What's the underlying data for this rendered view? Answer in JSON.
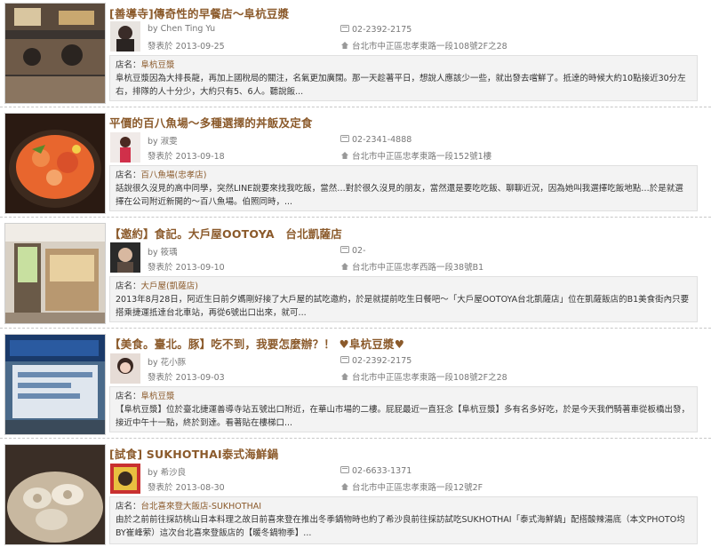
{
  "entries": [
    {
      "title": "[善導寺]傳奇性的早餐店～阜杭豆漿",
      "author": "by Chen Ting Yu",
      "date": "發表於 2013-09-25",
      "phone": "02-2392-2175",
      "address": "台北市中正區忠孝東路一段108號2F之28",
      "shop_label": "店名：",
      "shop_name": "阜杭豆漿",
      "excerpt": "阜杭豆漿因為大排長龍，再加上國稅局的關注，名氣更加廣闊。那一天趁著平日，想說人應該少一些，就出發去嚐鮮了。抵達的時候大約10點接近30分左右，排隊的人十分少，大約只有5、6人。聽說飯..."
    },
    {
      "title": "平價的百八魚場～多種選擇的丼飯及定食",
      "author": "by 淑雯",
      "date": "發表於 2013-09-18",
      "phone": "02-2341-4888",
      "address": "台北市中正區忠孝東路一段152號1樓",
      "shop_label": "店名：",
      "shop_name": "百八魚場(忠孝店)",
      "excerpt": "話說很久沒見的高中同學，突然LINE說要來找我吃飯，當然…對於很久沒見的朋友，當然還是要吃吃飯、聊聊近況，因為她叫我選擇吃飯地點…於是就選擇在公司附近新開的～百八魚場。伯照同時，..."
    },
    {
      "title": "【邀約】食記。大戶屋OOTOYA　台北凱薩店",
      "author": "by 筱瑀",
      "date": "發表於 2013-09-10",
      "phone": "02-",
      "address": "台北市中正區忠孝西路一段38號B1",
      "shop_label": "店名：",
      "shop_name": "大戶屋(凱薩店)",
      "excerpt": "2013年8月28日，阿近生日前夕媽剛好接了大戶屋的試吃邀約，於是就提前吃生日餐吧～「大戶屋OOTOYA台北凱薩店」位在凱薩飯店的B1美食街內只要搭乘捷運抵達台北車站，再從6號出口出來，就可..."
    },
    {
      "title": "【美食。臺北。豚】吃不到，我要怎麼辦？！ ♥阜杭豆漿♥",
      "author": "by 花小豚",
      "date": "發表於 2013-09-03",
      "phone": "02-2392-2175",
      "address": "台北市中正區忠孝東路一段108號2F之28",
      "shop_label": "店名：",
      "shop_name": "阜杭豆漿",
      "excerpt": "【阜杭豆漿】位於臺北捷運善導寺站五號出口附近，在華山市場的二樓。屁屁最近一直狂念【阜杭豆漿】多有名多好吃，於是今天我們騎著車從板橋出發，接近中午十一點，終於到達。看著貼在樓梯口..."
    },
    {
      "title": "[試食] SUKHOTHAI泰式海鮮鍋",
      "author": "by 希沙良",
      "date": "發表於 2013-08-30",
      "phone": "02-6633-1371",
      "address": "台北市中正區忠孝東路一段12號2F",
      "shop_label": "店名：",
      "shop_name": "台北喜來登大飯店-SUKHOTHAI",
      "excerpt": "由於之前前往採訪桃山日本料理之故日前喜來登在推出冬季鍋物時也約了希沙良前往採訪試吃SUKHOTHAI「泰式海鮮鍋」配搭酸辣湯底（本文PHOTO均BY崔峰萦）這次台北喜來登飯店的【暖冬鍋物季】..."
    }
  ],
  "colors": {
    "title": "#8b5a2b",
    "shop_name": "#8b5a2b",
    "box_bg": "#f3f3f3",
    "meta": "#777777"
  },
  "icons": {
    "phone": "phone-icon",
    "address": "location-icon"
  }
}
